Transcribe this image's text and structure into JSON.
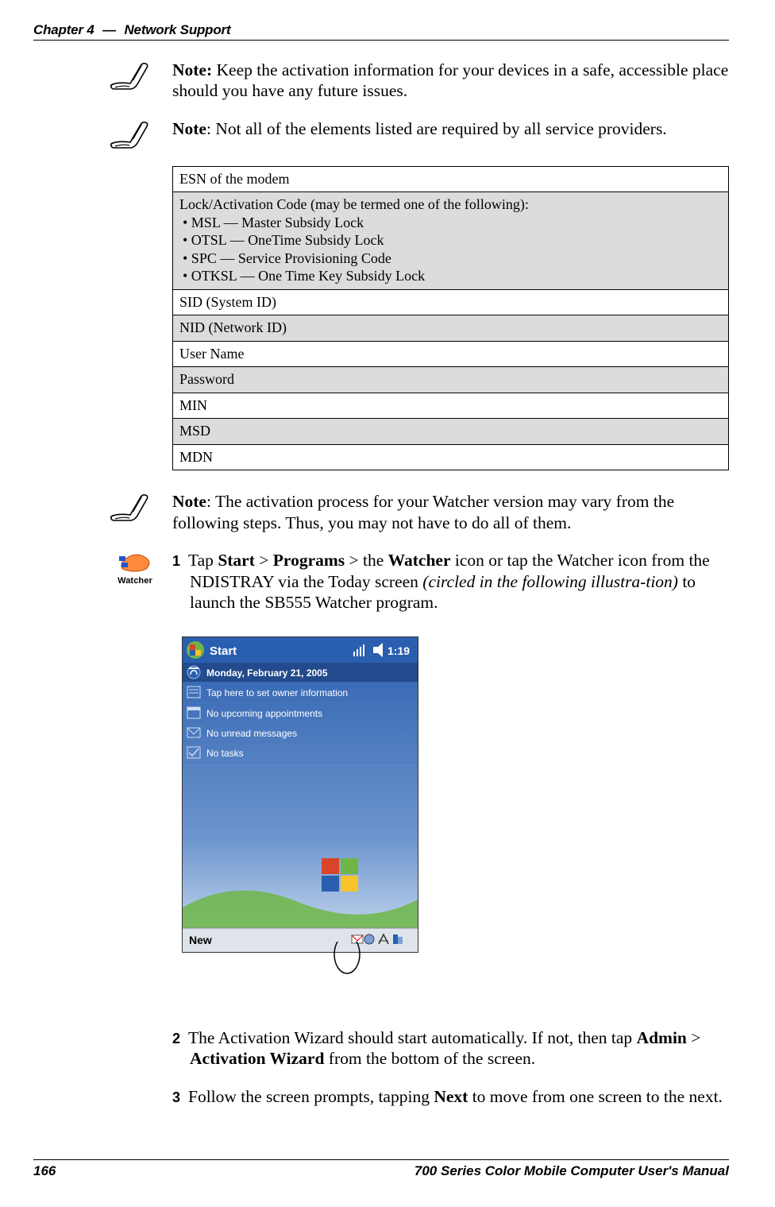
{
  "header": {
    "chapter": "Chapter 4",
    "dash": "—",
    "title": "Network Support"
  },
  "notes": {
    "n1_label": "Note:",
    "n1_text": " Keep the activation information for your devices in a safe, accessible place should you have any future issues.",
    "n2_label": "Note",
    "n2_text": ": Not all of the elements listed are required by all service providers.",
    "n3_label": "Note",
    "n3_text": ": The activation process for your Watcher version may vary from the following steps. Thus, you may not have to do all of them."
  },
  "table": {
    "r0": "ESN of the modem",
    "r1_head": "Lock/Activation Code (may be termed one of the following):",
    "r1_b1": "• MSL — Master Subsidy Lock",
    "r1_b2": "• OTSL — OneTime Subsidy Lock",
    "r1_b3": "• SPC — Service Provisioning Code",
    "r1_b4": "• OTKSL — One Time Key Subsidy Lock",
    "r2": "SID (System ID)",
    "r3": "NID (Network ID)",
    "r4": "User Name",
    "r5": "Password",
    "r6": "MIN",
    "r7": "MSD",
    "r8": "MDN"
  },
  "watcher": {
    "icon_label": "Watcher"
  },
  "steps": {
    "s1_num": "1",
    "s1_a": "Tap ",
    "s1_start": "Start",
    "s1_gt1": " > ",
    "s1_programs": "Programs",
    "s1_gt2": " > the ",
    "s1_watcher": "Watcher",
    "s1_b": " icon or tap the Watcher icon from the NDISTRAY via the Today screen ",
    "s1_italic": "(circled in the following illustra-tion)",
    "s1_c": " to launch the SB555 Watcher program.",
    "s2_num": "2",
    "s2_a": "The Activation Wizard should start automatically. If not, then tap ",
    "s2_admin": "Admin",
    "s2_gt": " > ",
    "s2_wiz": "Activation Wizard",
    "s2_b": " from the bottom of the screen.",
    "s3_num": "3",
    "s3_a": "Follow the screen prompts, tapping ",
    "s3_next": "Next",
    "s3_b": " to move from one screen to the next."
  },
  "pda": {
    "start": "Start",
    "time": "1:19",
    "date": "Monday, February 21, 2005",
    "owner": "Tap here to set owner information",
    "appts": "No upcoming appointments",
    "msgs": "No unread messages",
    "tasks": "No tasks",
    "new": "New"
  },
  "footer": {
    "page": "166",
    "manual": "700 Series Color Mobile Computer User's Manual"
  }
}
